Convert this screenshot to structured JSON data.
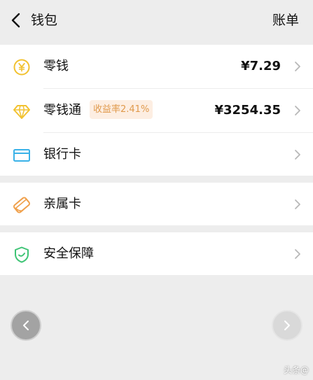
{
  "header": {
    "title": "钱包",
    "action_label": "账单",
    "back_icon": "chevron-left-icon"
  },
  "wallet_items": [
    {
      "label": "零钱",
      "value": "¥7.29",
      "icon": "yuan-coin-icon",
      "icon_color": "#f2c230"
    },
    {
      "label": "零钱通",
      "value": "¥3254.35",
      "badge": "收益率2.41%",
      "icon": "diamond-icon",
      "icon_color": "#f2c230"
    },
    {
      "label": "银行卡",
      "icon": "bank-card-icon",
      "icon_color": "#3ab2e8"
    },
    {
      "label": "亲属卡",
      "icon": "family-card-icon",
      "icon_color": "#f0a04b"
    },
    {
      "label": "安全保障",
      "icon": "shield-check-icon",
      "icon_color": "#3ec475"
    }
  ],
  "pager": {
    "prev_icon": "chevron-left-icon",
    "next_icon": "chevron-right-icon"
  },
  "watermark": "头条@",
  "colors": {
    "page_background": "#ededed",
    "card_background": "#ffffff",
    "badge_background": "#fdeee2",
    "badge_text": "#e09a4c"
  }
}
